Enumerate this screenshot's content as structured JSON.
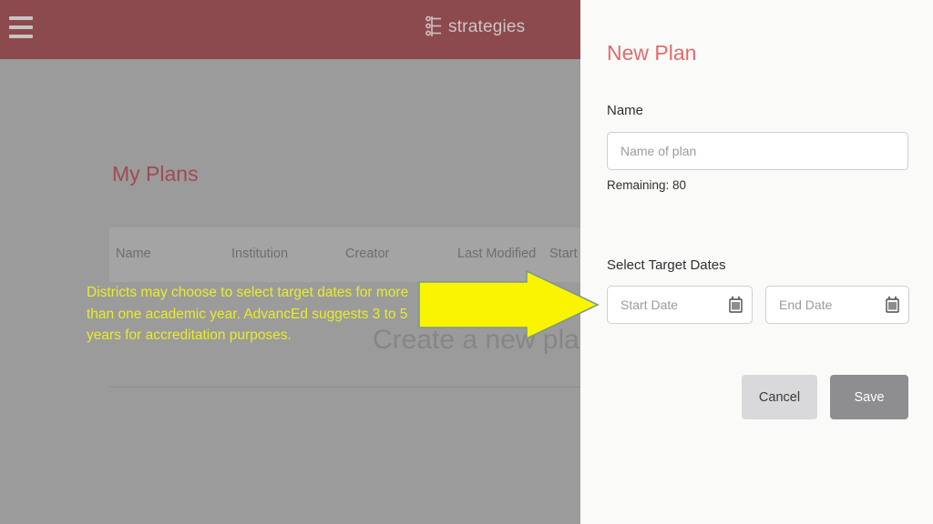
{
  "topbar": {
    "menu_icon": "hamburger-menu-icon",
    "brand_icon": "strategies-logo-icon",
    "brand_text": "strategies",
    "bar_color": "#8c4a4e"
  },
  "background_page": {
    "page_title": "My Plans",
    "title_color": "#a04a55",
    "table": {
      "columns": [
        "Name",
        "Institution",
        "Creator",
        "Last Modified",
        "Start D"
      ]
    },
    "empty_state_text": "Create a new plan"
  },
  "annotation": {
    "note_text": "Districts may choose to select target dates for more than one academic year.  AdvancEd suggests 3 to 5 years for accreditation purposes.",
    "color": "#e9ec2a",
    "arrow_icon": "right-arrow-annotation-icon"
  },
  "panel": {
    "title": "New Plan",
    "title_color": "#e16b6b",
    "name": {
      "label": "Name",
      "value": "",
      "placeholder": "Name of plan",
      "remaining_text": "Remaining: 80"
    },
    "dates": {
      "label": "Select Target Dates",
      "start": {
        "value": "",
        "placeholder": "Start Date",
        "icon": "calendar-icon"
      },
      "end": {
        "value": "",
        "placeholder": "End Date",
        "icon": "calendar-icon"
      }
    },
    "buttons": {
      "cancel": "Cancel",
      "save": "Save"
    }
  }
}
